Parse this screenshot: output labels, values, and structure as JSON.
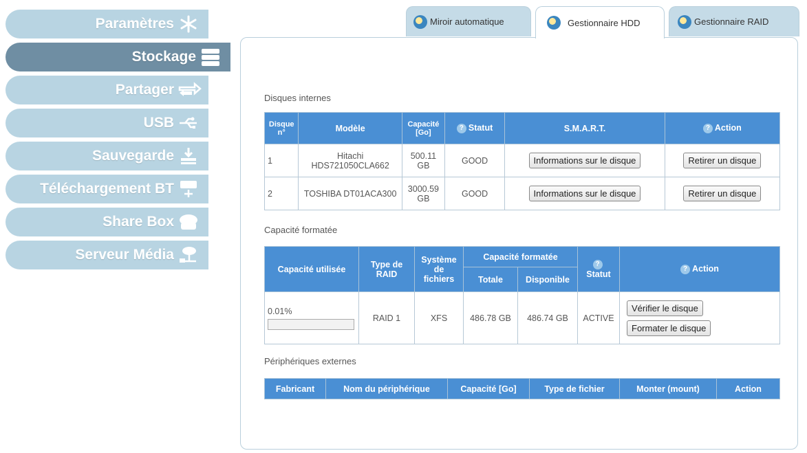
{
  "sidebar": {
    "items": [
      {
        "label": "Paramètres",
        "icon": "snowflake-icon",
        "active": false
      },
      {
        "label": "Stockage",
        "icon": "storage-stack-icon",
        "active": true
      },
      {
        "label": "Partager",
        "icon": "share-arrows-icon",
        "active": false
      },
      {
        "label": "USB",
        "icon": "usb-icon",
        "active": false
      },
      {
        "label": "Sauvegarde",
        "icon": "download-tray-icon",
        "active": false
      },
      {
        "label": "Téléchargement BT",
        "icon": "bittorrent-icon",
        "active": false
      },
      {
        "label": "Share Box",
        "icon": "share-box-icon",
        "active": false
      },
      {
        "label": "Serveur Média",
        "icon": "media-server-icon",
        "active": false
      }
    ]
  },
  "tabs": [
    {
      "label": "Miroir automatique",
      "icon": "tab-disc-icon"
    },
    {
      "label": "Gestionnaire HDD",
      "icon": "tab-disc-icon",
      "active": true
    },
    {
      "label": "Gestionnaire RAID",
      "icon": "tab-disc-icon"
    }
  ],
  "internal": {
    "title": "Disques internes",
    "headers": {
      "disk": "Disque n°",
      "model": "Modèle",
      "capacity": "Capacité [Go]",
      "status": "Statut",
      "smart": "S.M.A.R.T.",
      "action": "Action"
    },
    "rows": [
      {
        "num": "1",
        "model": "Hitachi HDS721050CLA662",
        "capacity": "500.11 GB",
        "status": "GOOD",
        "smart_button": "Informations sur le disque",
        "action_button": "Retirer un disque"
      },
      {
        "num": "2",
        "model": "TOSHIBA DT01ACA300",
        "capacity": "3000.59 GB",
        "status": "GOOD",
        "smart_button": "Informations sur le disque",
        "action_button": "Retirer un disque"
      }
    ]
  },
  "formatted": {
    "title": "Capacité formatée",
    "headers": {
      "used": "Capacité utilisée",
      "raid_type": "Type de RAID",
      "fs": "Système de fichiers",
      "formatted_cap": "Capacité formatée",
      "total": "Totale",
      "available": "Disponible",
      "status": "Statut",
      "action": "Action"
    },
    "row": {
      "used": "0.01%",
      "used_fraction": 0.0001,
      "raid_type": "RAID 1",
      "fs": "XFS",
      "total": "486.78 GB",
      "available": "486.74 GB",
      "status": "ACTIVE",
      "verify_button": "Vérifier le disque",
      "format_button": "Formater le disque"
    }
  },
  "external": {
    "title": "Périphériques externes",
    "headers": [
      "Fabricant",
      "Nom du périphérique",
      "Capacité [Go]",
      "Type de fichier",
      "Monter (mount)",
      "Action"
    ]
  },
  "help_glyph": "?",
  "colors": {
    "header_blue": "#4a8fd4",
    "sidebar_light": "#b8d4e2",
    "sidebar_active": "#6f8ea3",
    "tab_bg": "#c5dbe7"
  }
}
